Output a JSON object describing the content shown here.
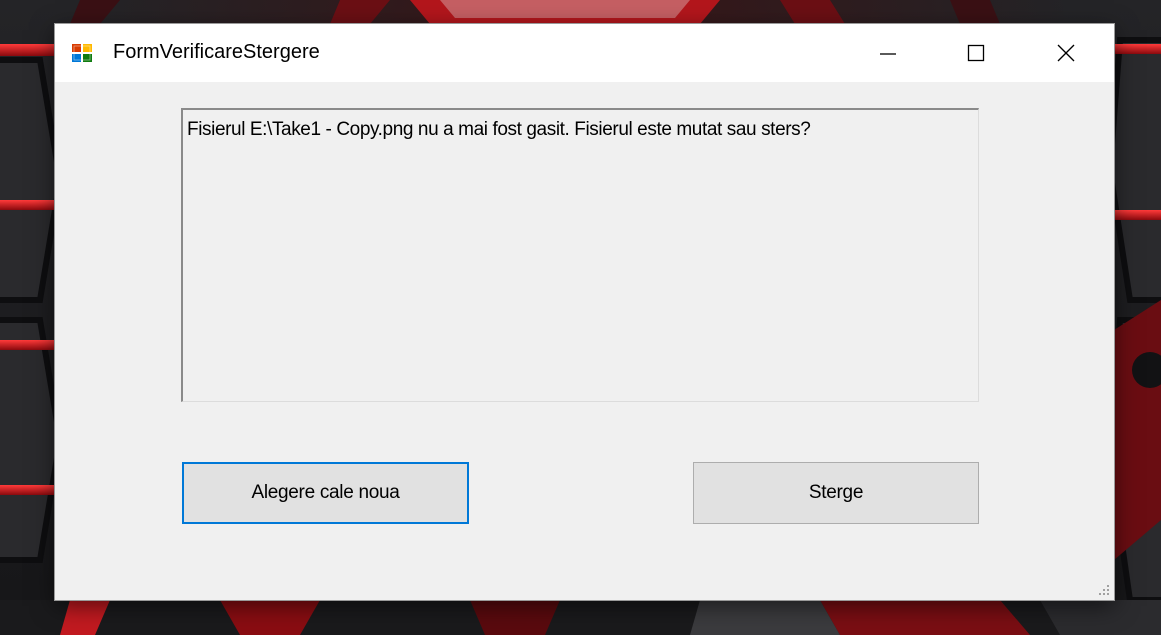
{
  "window": {
    "title": "FormVerificareStergere",
    "icon": "winforms-app-icon"
  },
  "caption_buttons": {
    "minimize_icon": "minimize-icon",
    "maximize_icon": "maximize-icon",
    "close_icon": "close-icon"
  },
  "message": {
    "text": "Fisierul E:\\Take1 - Copy.png nu a mai fost gasit. Fisierul este mutat sau sters?"
  },
  "buttons": {
    "choose_new_path_label": "Alegere cale noua",
    "delete_label": "Sterge"
  },
  "colors": {
    "accent": "#0078d7",
    "window_bg": "#f0f0f0",
    "titlebar_bg": "#ffffff",
    "button_bg": "#e1e1e1"
  }
}
